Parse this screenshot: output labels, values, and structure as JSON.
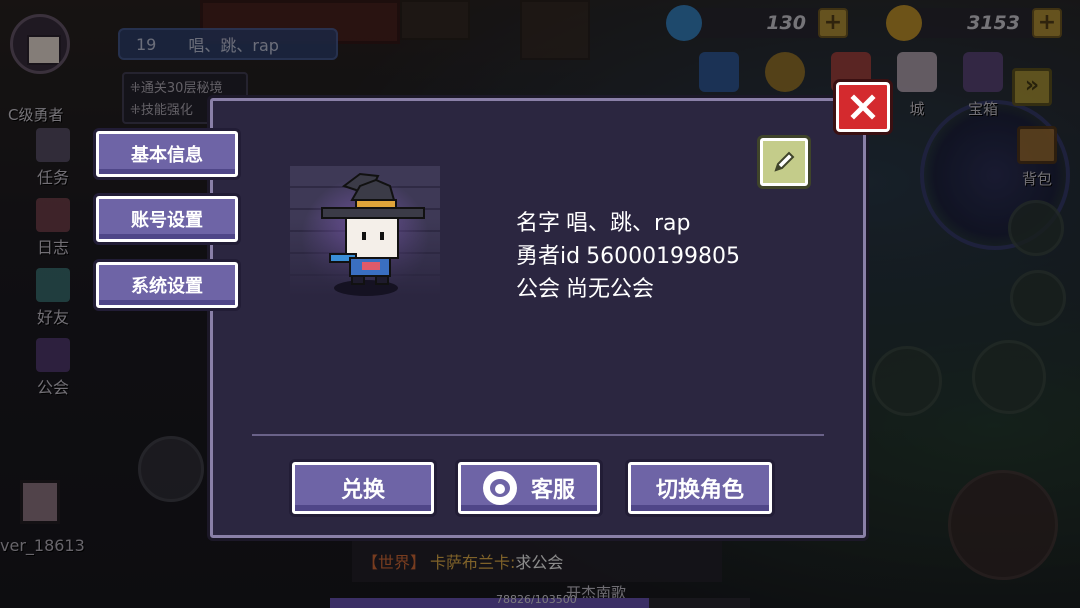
{
  "hud": {
    "rank_label": "C级勇者",
    "player_level": "19",
    "player_name": "唱、跳、rap",
    "quests": [
      "通关30层秘境",
      "技能强化"
    ],
    "side_menu": [
      {
        "label": "任务",
        "icon": "quest-icon"
      },
      {
        "label": "日志",
        "icon": "log-icon"
      },
      {
        "label": "好友",
        "icon": "friends-icon"
      },
      {
        "label": "公会",
        "icon": "guild-icon"
      }
    ],
    "gems": "130",
    "gold": "3153",
    "top_icons": [
      {
        "label": "",
        "icon": "gift-box-icon"
      },
      {
        "label": "",
        "icon": "badge-icon"
      },
      {
        "label": "",
        "icon": "calendar-icon"
      },
      {
        "label": "城",
        "icon": "bunny-icon"
      },
      {
        "label": "宝箱",
        "icon": "chest-icon"
      }
    ],
    "next_arrow": "»",
    "backpack_label": "背包",
    "player_tag": "ver_18613",
    "xp_text": "78826/103500",
    "xp_fraction": 0.76,
    "chat": {
      "channel": "【世界】",
      "sender": "卡萨布兰卡:",
      "message": "求公会"
    },
    "chat_sub": "开杰南歌"
  },
  "dialog": {
    "tabs": [
      "基本信息",
      "账号设置",
      "系统设置"
    ],
    "info": {
      "name_label": "名字",
      "name_value": "唱、跳、rap",
      "id_label": "勇者id",
      "id_value": "56000199805",
      "guild_label": "公会",
      "guild_value": "尚无公会"
    },
    "actions": {
      "redeem": "兑换",
      "support": "客服",
      "switch_role": "切换角色"
    }
  },
  "colors": {
    "panel": "#2b2640",
    "button": "#6e64a6",
    "close": "#d42a2e",
    "edit": "#c4cc8a"
  }
}
